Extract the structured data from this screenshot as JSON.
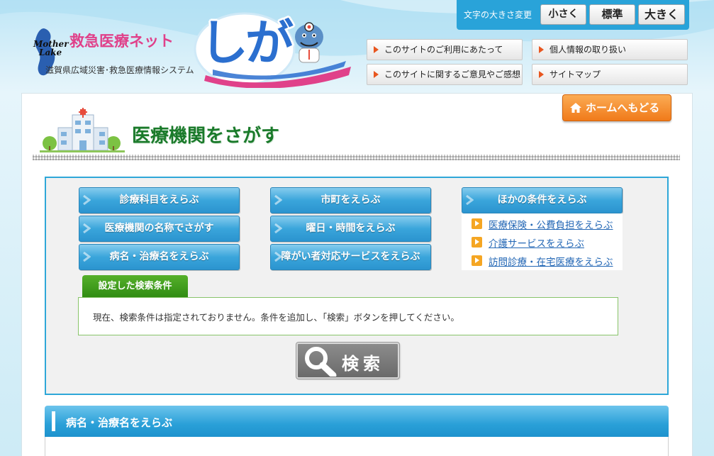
{
  "header": {
    "logo_mark": "Mother Lake",
    "logo_mark_line1": "Mother",
    "logo_mark_line2": "Lake",
    "site_name": "救急医療ネット",
    "site_subtitle": "滋賀県広域災害･救急医療情報システム",
    "logo_word": "しが"
  },
  "font_size": {
    "label": "文字の大きさ変更",
    "small": "小さく",
    "normal": "標準",
    "large": "大きく"
  },
  "top_links": {
    "about": "このサイトのご利用にあたって",
    "privacy": "個人情報の取り扱い",
    "feedback": "このサイトに関するご意見やご感想",
    "sitemap": "サイトマップ"
  },
  "home_button": "ホームへもどる",
  "page_title": "医療機関をさがす",
  "search": {
    "col1": [
      "診療科目をえらぶ",
      "医療機関の名称でさがす",
      "病名・治療名をえらぶ"
    ],
    "col2": [
      "市町をえらぶ",
      "曜日・時間をえらぶ",
      "障がい者対応サービスをえらぶ"
    ],
    "other_header": "ほかの条件をえらぶ",
    "other_links": [
      "医療保険・公費負担をえらぶ",
      "介護サービスをえらぶ",
      "訪問診療・在宅医療をえらぶ"
    ],
    "conditions_tab": "設定した検索条件",
    "conditions_text": "現在、検索条件は指定されておりません。条件を追加し、「検索」ボタンを押してください。",
    "search_button": "検索"
  },
  "section": {
    "title": "病名・治療名をえらぶ"
  },
  "colors": {
    "accent_blue": "#2ea7d8",
    "title_green": "#1a7a2a",
    "home_orange": "#f07a1a",
    "tab_green": "#3f9c1c"
  }
}
